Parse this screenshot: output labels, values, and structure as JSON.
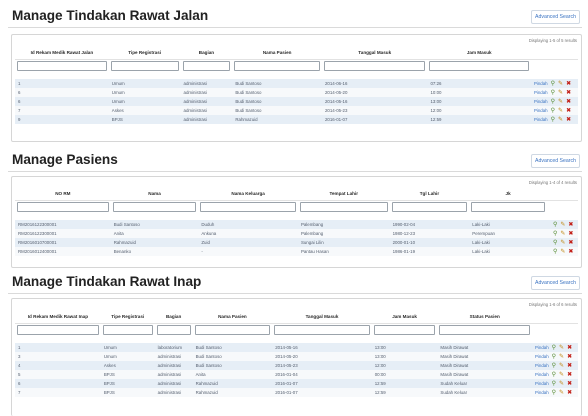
{
  "sections": [
    {
      "title": "Manage Tindakan Rawat Jalan",
      "advanced": "Advanced Search",
      "summary": "Displaying 1-5 of 5 results",
      "columns": [
        "Id Rekam Medik Rawat Jalan",
        "Tipe Registrasi",
        "Bagian",
        "Nama Pasien",
        "Tanggal Masuk",
        "Jam Masuk"
      ],
      "rows": [
        [
          "1",
          "Umum",
          "administrasi",
          "Budi Santoso",
          "2014-06-16",
          "07:26",
          "Pindah"
        ],
        [
          "6",
          "Umum",
          "administrasi",
          "Budi Santoso",
          "2014-05-20",
          "10:00",
          "Pindah"
        ],
        [
          "6",
          "Umum",
          "administrasi",
          "Budi Santoso",
          "2014-05-16",
          "13:00",
          "Pindah"
        ],
        [
          "7",
          "Askes",
          "administrasi",
          "Budi Santoso",
          "2014-05-23",
          "12:00",
          "Pindah"
        ],
        [
          "9",
          "BPJS",
          "administrasi",
          "Rahmazuid",
          "2016-01-07",
          "12:59",
          "Pindah"
        ]
      ]
    },
    {
      "title": "Manage Pasiens",
      "advanced": "Advanced Search",
      "summary": "Displaying 1-4 of 4 results",
      "columns": [
        "NO RM",
        "Nama",
        "Nama Keluarga",
        "Tempat Lahir",
        "Tgl Lahir",
        "Jk"
      ],
      "rows": [
        [
          "RM2016122300001",
          "Budi Santoso",
          "Duduh",
          "Palembang",
          "1990-02-04",
          "Laki-Laki",
          ""
        ],
        [
          "RM2016122300001",
          "Anita",
          "Ankuna",
          "Palembang",
          "1980-12-23",
          "Perempuan",
          ""
        ],
        [
          "RM2016010700001",
          "Rahmazuid",
          "Zuid",
          "Sungai Lilin",
          "2000-01-10",
          "Laki-Laki",
          ""
        ],
        [
          "RM2016012400001",
          "Benanko",
          "-",
          "Pantau Hasan",
          "1986-01-19",
          "Laki-Laki",
          ""
        ]
      ]
    },
    {
      "title": "Manage Tindakan Rawat Inap",
      "advanced": "Advanced Search",
      "summary": "Displaying 1-6 of 6 results",
      "columns": [
        "Id Rekam Medik Rawat Inap",
        "Tipe Registrasi",
        "Bagian",
        "Nama Pasien",
        "Tanggal Masuk",
        "Jam Masuk",
        "Status Pasien"
      ],
      "rows": [
        [
          "1",
          "Umum",
          "laboratorium",
          "Budi Santoso",
          "2014-05-16",
          "13:00",
          "Masih Dirawat",
          "Pindah"
        ],
        [
          "3",
          "Umum",
          "administrasi",
          "Budi Santoso",
          "2014-05-20",
          "13:00",
          "Masih Dirawat",
          "Pindah"
        ],
        [
          "4",
          "Askes",
          "administrasi",
          "Budi Santoso",
          "2014-05-23",
          "12:00",
          "Masih Dirawat",
          "Pindah"
        ],
        [
          "5",
          "BPJS",
          "administrasi",
          "Anita",
          "2016-01-04",
          "00:00",
          "Masih Dirawat",
          "Pindah"
        ],
        [
          "6",
          "BPJS",
          "administrasi",
          "Rahmazuid",
          "2016-01-07",
          "12:59",
          "Sudah Keluar",
          "Pindah"
        ],
        [
          "7",
          "BPJS",
          "administrasi",
          "Rahmazuid",
          "2016-01-07",
          "12:59",
          "Sudah Keluar",
          "Pindah"
        ]
      ]
    }
  ],
  "icons": {
    "view": "magnifier-view-icon",
    "update": "pencil-edit-icon",
    "delete": "delete-x-icon"
  }
}
